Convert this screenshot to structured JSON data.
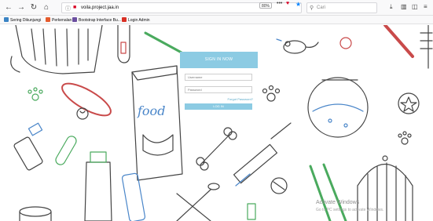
{
  "browser": {
    "url": "voila.project.jaa.in",
    "zoom": "80%",
    "url_more": "•••",
    "search_placeholder": "Cari",
    "icons": [
      "back-icon",
      "forward-icon",
      "reload-icon",
      "home-icon",
      "site-info-icon",
      "lock-icon",
      "pocket-icon",
      "bookmark-star-icon",
      "search-icon",
      "downloads-icon",
      "library-icon",
      "sidebar-icon",
      "menu-icon"
    ]
  },
  "bookmarks": [
    {
      "label": "Sering Dikunjungi",
      "color": "#3b84c4"
    },
    {
      "label": "Perkenalan",
      "color": "#e55b2d"
    },
    {
      "label": "Bootstrap Interface Bu...",
      "color": "#6b4fa0"
    },
    {
      "label": "Login Admin",
      "color": "#d93025"
    }
  ],
  "login": {
    "title": "SIGN IN NOW",
    "username_placeholder": "Username",
    "password_placeholder": "Password",
    "forgot": "Forgot Password?",
    "button": "LOG IN",
    "accent": "#8ccbe3"
  },
  "background": {
    "food_label": "food"
  },
  "watermark": {
    "title": "Activate Windows",
    "subtitle": "Go to PC settings to activate Windows."
  }
}
